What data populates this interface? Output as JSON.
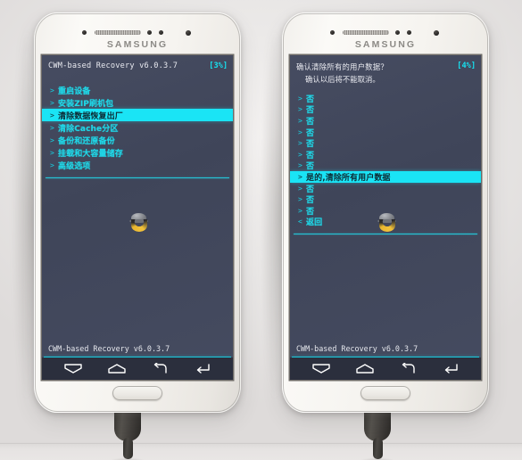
{
  "scene": {
    "description": "Two Samsung Galaxy phones side by side showing CWM recovery screens",
    "brand_label": "SAMSUNG",
    "background_color": "#eceaea",
    "accent_cyan": "#1fd8e8",
    "highlight_cyan": "#1ae4f5",
    "screen_bg": "#434960"
  },
  "nav_icons": [
    {
      "name": "menu-icon",
      "glyph": "menu"
    },
    {
      "name": "home-icon",
      "glyph": "home"
    },
    {
      "name": "back-icon",
      "glyph": "back"
    },
    {
      "name": "enter-icon",
      "glyph": "enter"
    }
  ],
  "left_phone": {
    "label": "left-phone",
    "screen": {
      "header": {
        "title": "CWM-based Recovery v6.0.3.7",
        "badge": "[3%]"
      },
      "menu_items": [
        {
          "chevron": ">",
          "label": "重启设备",
          "selected": false
        },
        {
          "chevron": ">",
          "label": "安装ZIP刷机包",
          "selected": false
        },
        {
          "chevron": ">",
          "label": "清除数据恢复出厂",
          "selected": true
        },
        {
          "chevron": ">",
          "label": "清除Cache分区",
          "selected": false
        },
        {
          "chevron": ">",
          "label": "备份和还原备份",
          "selected": false
        },
        {
          "chevron": ">",
          "label": "挂载和大容量储存",
          "selected": false
        },
        {
          "chevron": ">",
          "label": "高级选项",
          "selected": false
        }
      ],
      "footer_status": "CWM-based Recovery v6.0.3.7"
    }
  },
  "right_phone": {
    "label": "right-phone",
    "screen": {
      "header": {
        "title": "确认清除所有的用户数据？",
        "subtitle": "确认以后将不能取消。",
        "badge": "[4%]"
      },
      "menu_items": [
        {
          "chevron": ">",
          "label": "否",
          "selected": false
        },
        {
          "chevron": ">",
          "label": "否",
          "selected": false
        },
        {
          "chevron": ">",
          "label": "否",
          "selected": false
        },
        {
          "chevron": ">",
          "label": "否",
          "selected": false
        },
        {
          "chevron": ">",
          "label": "否",
          "selected": false
        },
        {
          "chevron": ">",
          "label": "否",
          "selected": false
        },
        {
          "chevron": ">",
          "label": "否",
          "selected": false
        },
        {
          "chevron": ">",
          "label": "是的,清除所有用户数据",
          "selected": true
        },
        {
          "chevron": ">",
          "label": "否",
          "selected": false
        },
        {
          "chevron": ">",
          "label": "否",
          "selected": false
        },
        {
          "chevron": ">",
          "label": "否",
          "selected": false
        },
        {
          "chevron": "<",
          "label": "返回",
          "selected": false
        }
      ],
      "footer_status": "CWM-based Recovery v6.0.3.7"
    }
  }
}
